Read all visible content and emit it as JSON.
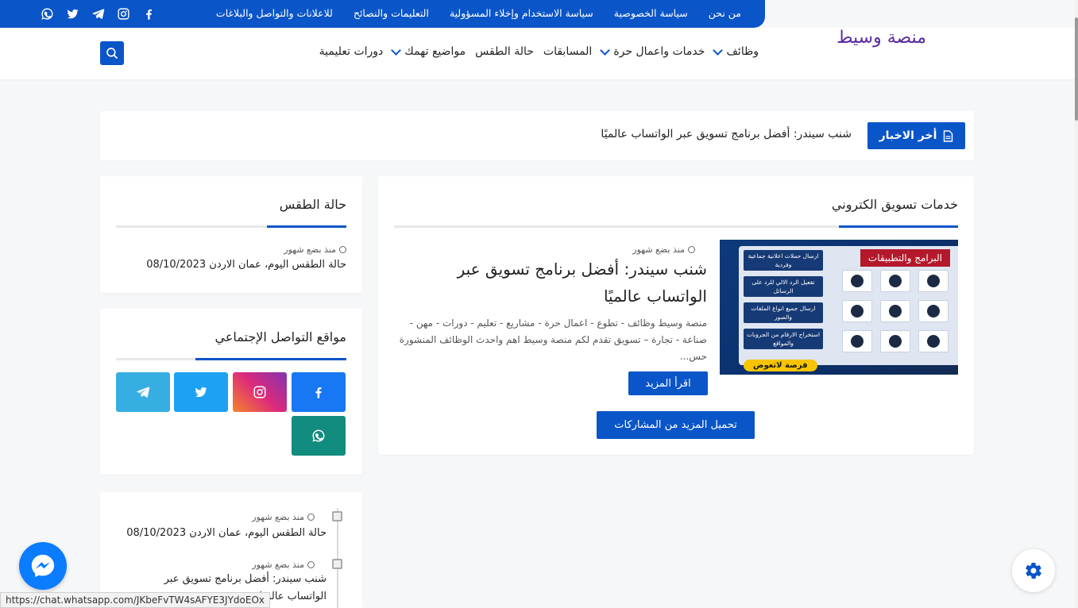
{
  "topbar": {
    "links": [
      "من نحن",
      "سياسة الخصوصية",
      "سياسة الاستخدام وإخلاء المسؤولية",
      "التعليمات والنصائح",
      "للاعلانات والتواصل والبلاغات"
    ],
    "social_icons": [
      "facebook-icon",
      "instagram-icon",
      "telegram-icon",
      "twitter-icon",
      "whatsapp-icon"
    ]
  },
  "header": {
    "logo": "منصة وسيط",
    "nav": [
      {
        "label": "وظائف",
        "dropdown": true
      },
      {
        "label": "خدمات واعمال حرة",
        "dropdown": true
      },
      {
        "label": "المسابقات",
        "dropdown": false
      },
      {
        "label": "حالة الطقس",
        "dropdown": false
      },
      {
        "label": "مواضيع تهمك",
        "dropdown": true
      },
      {
        "label": "دورات تعليمية",
        "dropdown": false
      }
    ],
    "search_icon": "search-icon"
  },
  "ticker": {
    "button_label": "أخر الاخبار",
    "headline": "شنب سيندر: أفضل برنامج تسويق عبر الواتساب عالميًا"
  },
  "main": {
    "section_title": "خدمات تسويق الكتروني",
    "post": {
      "category": "البرامج والتطبيقات",
      "image_panels": [
        "ارسال حملات اعلانية جماعية وفردية",
        "تفعيل الرد الالي للرد على الرسائل",
        "ارسال جميع انواع الملفات والصور",
        "استخراج الارقام من الجروبات والمواقع"
      ],
      "image_promo": "فرصة لاتعوض",
      "meta": "منذ بضع شهور",
      "title": "شنب سيندر: أفضل برنامج تسويق عبر الواتساب عالميًا",
      "excerpt": "منصة وسيط وظائف - تطوع - اعمال حرة - مشاريع - تعليم - دورات - مهن - صناعة - تجارة – تسويق تقدم لكم منصة وسيط اهم واحدث الوظائف المنشورة حس...",
      "read_more": "اقرأ المزيد"
    },
    "load_more": "تحميل المزيد من المشاركات"
  },
  "sidebar": {
    "weather": {
      "title": "حالة الطقس",
      "meta": "منذ بضع شهور",
      "item": "حالة الطقس اليوم، عمان الاردن 08/10/2023"
    },
    "social": {
      "title": "مواقع التواصل الإجتماعي",
      "tiles": [
        {
          "icon": "facebook-icon",
          "color": "#1877f2"
        },
        {
          "icon": "instagram-icon",
          "color": "#d62976"
        },
        {
          "icon": "twitter-icon",
          "color": "#1da1f2"
        },
        {
          "icon": "telegram-icon",
          "color": "#37aee2"
        },
        {
          "icon": "whatsapp-icon",
          "color": "#128c7e"
        }
      ]
    },
    "timeline": [
      {
        "meta": "منذ بضع شهور",
        "title": "حالة الطقس اليوم، عمان الاردن 08/10/2023"
      },
      {
        "meta": "منذ بضع شهور",
        "title_line1": "شنب سيندر: أفضل برنامج تسويق عبر",
        "title_line2": "الواتساب عالميًا"
      }
    ]
  },
  "floating": {
    "messenger_icon": "messenger-icon",
    "settings_icon": "gear-icon"
  },
  "statusbar": {
    "url": "https://chat.whatsapp.com/JKbeFvTW4sAFYE3JYdoEOx"
  },
  "colors": {
    "accent": "#0a55c8",
    "logo": "#5b2aa0",
    "category_badge": "#b3192b"
  }
}
